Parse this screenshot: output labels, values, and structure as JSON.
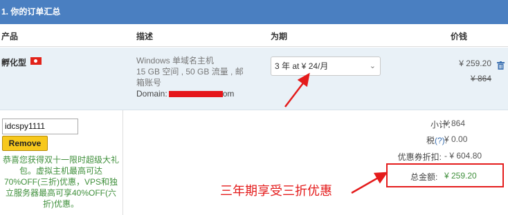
{
  "section_title": "1.  你的订单汇总",
  "columns": {
    "product": "产品",
    "description": "描述",
    "period": "为期",
    "price": "价钱"
  },
  "item": {
    "name": "孵化型",
    "flag": "hong-kong-flag",
    "desc_line1": "Windows 单域名主机",
    "desc_line2": "15 GB 空间 , 50 GB 流量 , 邮",
    "desc_line3": "箱账号",
    "domain_label": "Domain:",
    "domain_suffix": "om",
    "period_selected": "3 年 at ¥ 24/月",
    "price": "¥ 259.20",
    "original_price": "¥ 864"
  },
  "coupon": {
    "code": "idcspy1111",
    "remove_label": "Remove"
  },
  "promo_text": "恭喜您获得双十一限时超级大礼包。虚拟主机最高可达70%OFF(三折)优惠，VPS和独立服务器最高可享40%OFF(六折)优惠。",
  "summary": {
    "subtotal_label": "小计：",
    "subtotal_value": "¥ 864",
    "tax_label": "税",
    "tax_link": "(?)",
    "tax_colon": ":",
    "tax_value": "¥ 0.00",
    "discount_label": "优惠券折扣:",
    "discount_value": "- ¥ 604.80",
    "total_label": "总金额:",
    "total_value": "¥ 259.20"
  },
  "annotation": "三年期享受三折优惠",
  "colors": {
    "header_bar": "#4a7fc1",
    "annotation_red": "#e41b1b",
    "promo_green": "#3f8f3b",
    "button_yellow": "#f7c81c"
  }
}
